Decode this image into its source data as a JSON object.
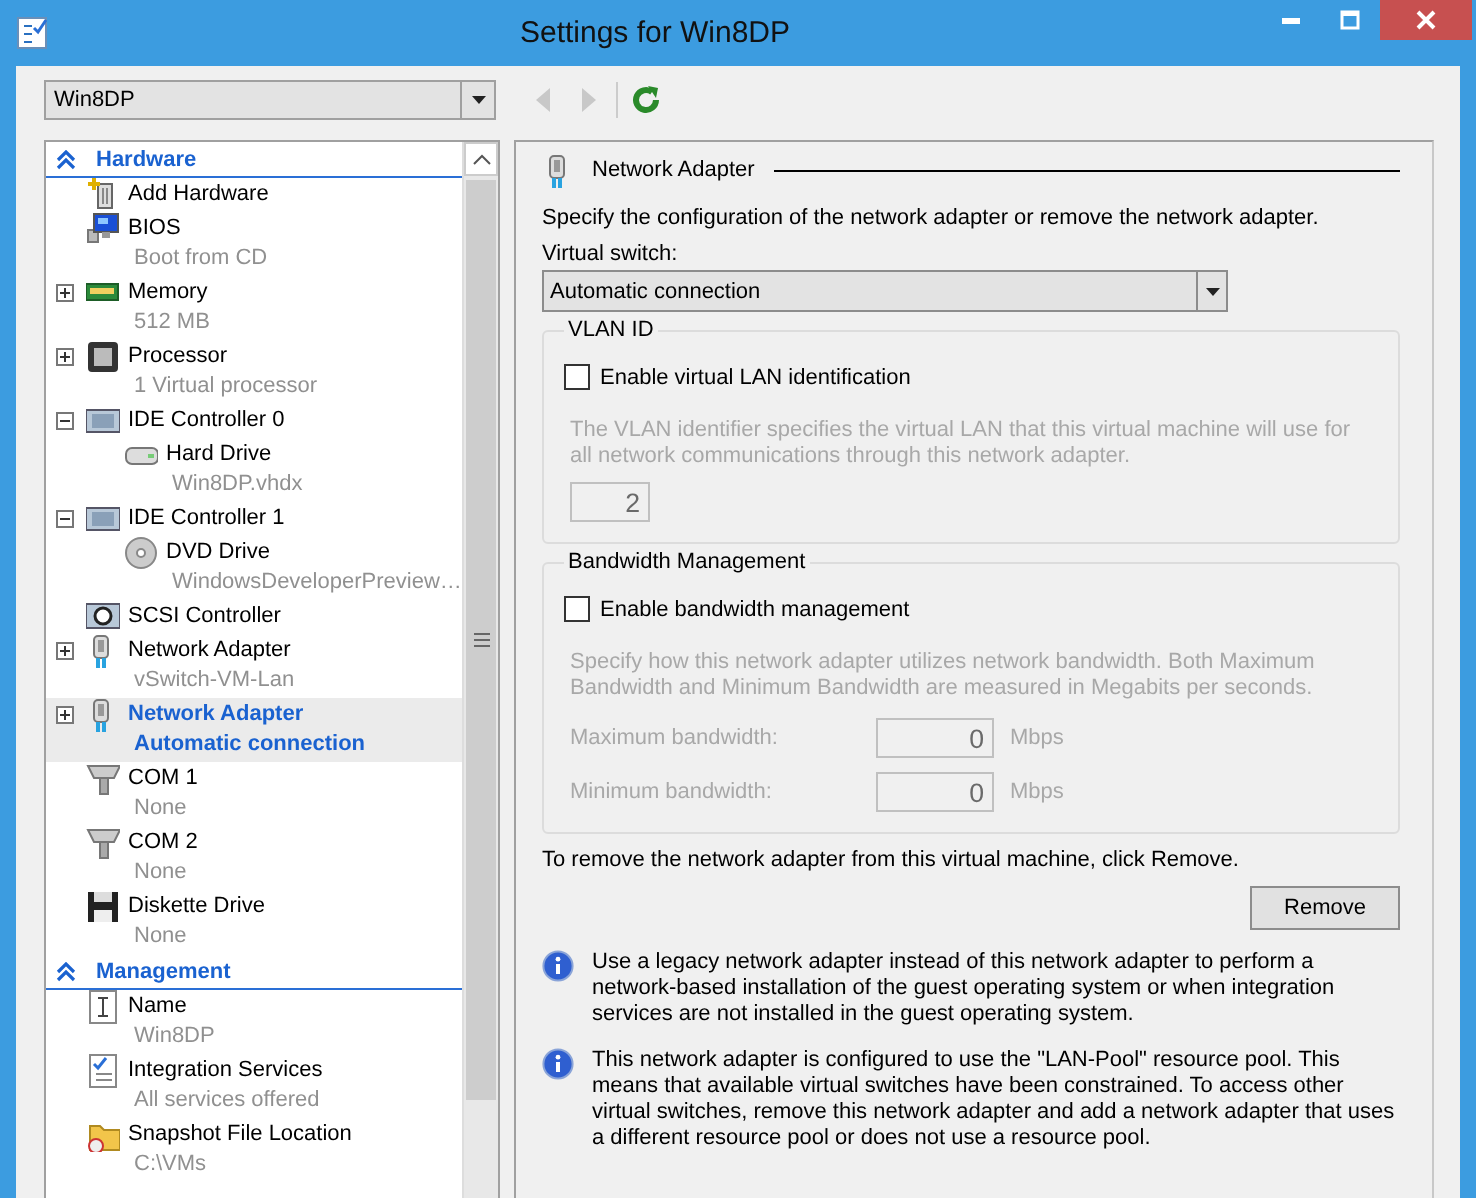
{
  "window": {
    "title": "Settings for Win8DP"
  },
  "toolbar": {
    "vm_selector": {
      "value": "Win8DP"
    },
    "nav_buttons": [
      {
        "kind": "back",
        "disabled": true
      },
      {
        "kind": "forward",
        "disabled": true
      },
      {
        "kind": "refresh",
        "disabled": false
      }
    ]
  },
  "tree": {
    "sections": [
      {
        "title": "Hardware",
        "expanded": true,
        "items": [
          {
            "kind": "add-hardware",
            "name": "Add Hardware",
            "selected": false
          },
          {
            "kind": "bios",
            "name": "BIOS",
            "detail": "Boot from CD",
            "selected": false
          },
          {
            "kind": "memory",
            "name": "Memory",
            "detail": "512 MB",
            "expanded": false,
            "selected": false
          },
          {
            "kind": "processor",
            "name": "Processor",
            "detail": "1 Virtual processor",
            "expanded": false,
            "selected": false
          },
          {
            "kind": "controller",
            "name": "IDE Controller 0",
            "expanded": true,
            "selected": false,
            "children": [
              {
                "kind": "hard-drive",
                "name": "Hard Drive",
                "detail": "Win8DP.vhdx",
                "selected": false
              }
            ]
          },
          {
            "kind": "controller",
            "name": "IDE Controller 1",
            "expanded": true,
            "selected": false,
            "children": [
              {
                "kind": "dvd",
                "name": "DVD Drive",
                "detail": "WindowsDeveloperPreview…",
                "selected": false
              }
            ]
          },
          {
            "kind": "scsi",
            "name": "SCSI Controller",
            "selected": false
          },
          {
            "kind": "network",
            "name": "Network Adapter",
            "detail": "vSwitch-VM-Lan",
            "expanded": false,
            "selected": false
          },
          {
            "kind": "network",
            "name": "Network Adapter",
            "detail": "Automatic connection",
            "expanded": false,
            "selected": true
          },
          {
            "kind": "com",
            "name": "COM 1",
            "detail": "None",
            "selected": false
          },
          {
            "kind": "com",
            "name": "COM 2",
            "detail": "None",
            "selected": false
          },
          {
            "kind": "diskette",
            "name": "Diskette Drive",
            "detail": "None",
            "selected": false
          }
        ]
      },
      {
        "title": "Management",
        "expanded": true,
        "items": [
          {
            "kind": "name",
            "name": "Name",
            "detail": "Win8DP",
            "selected": false
          },
          {
            "kind": "integration",
            "name": "Integration Services",
            "detail": "All services offered",
            "selected": false
          },
          {
            "kind": "snapshot",
            "name": "Snapshot File Location",
            "detail": "C:\\VMs",
            "selected": false
          }
        ]
      }
    ]
  },
  "pane": {
    "title": "Network Adapter",
    "description": "Specify the configuration of the network adapter or remove the network adapter.",
    "virtual_switch": {
      "label": "Virtual switch:",
      "value": "Automatic connection"
    },
    "groups": [
      {
        "title": "VLAN ID",
        "checkbox": {
          "label": "Enable virtual LAN identification",
          "checked": false
        },
        "note": "The VLAN identifier specifies the virtual LAN that this virtual machine will use for all network communications through this network adapter.",
        "fields": [
          {
            "value": "2",
            "disabled": true
          }
        ]
      },
      {
        "title": "Bandwidth Management",
        "checkbox": {
          "label": "Enable bandwidth management",
          "checked": false
        },
        "note": "Specify how this network adapter utilizes network bandwidth. Both Maximum Bandwidth and Minimum Bandwidth are measured in Megabits per seconds.",
        "fields": [
          {
            "label": "Maximum bandwidth:",
            "value": "0",
            "unit": "Mbps",
            "disabled": true
          },
          {
            "label": "Minimum bandwidth:",
            "value": "0",
            "unit": "Mbps",
            "disabled": true
          }
        ]
      }
    ],
    "remove_text": "To remove the network adapter from this virtual machine, click Remove.",
    "remove_button": "Remove",
    "info_notes": [
      "Use a legacy network adapter instead of this network adapter to perform a network-based installation of the guest operating system or when integration services are not installed in the guest operating system.",
      "This network adapter is configured to use the \"LAN-Pool\" resource pool. This means that available virtual switches have been constrained. To access other virtual switches, remove this network adapter and add a network adapter that uses a different resource pool or does not use a resource pool."
    ]
  }
}
